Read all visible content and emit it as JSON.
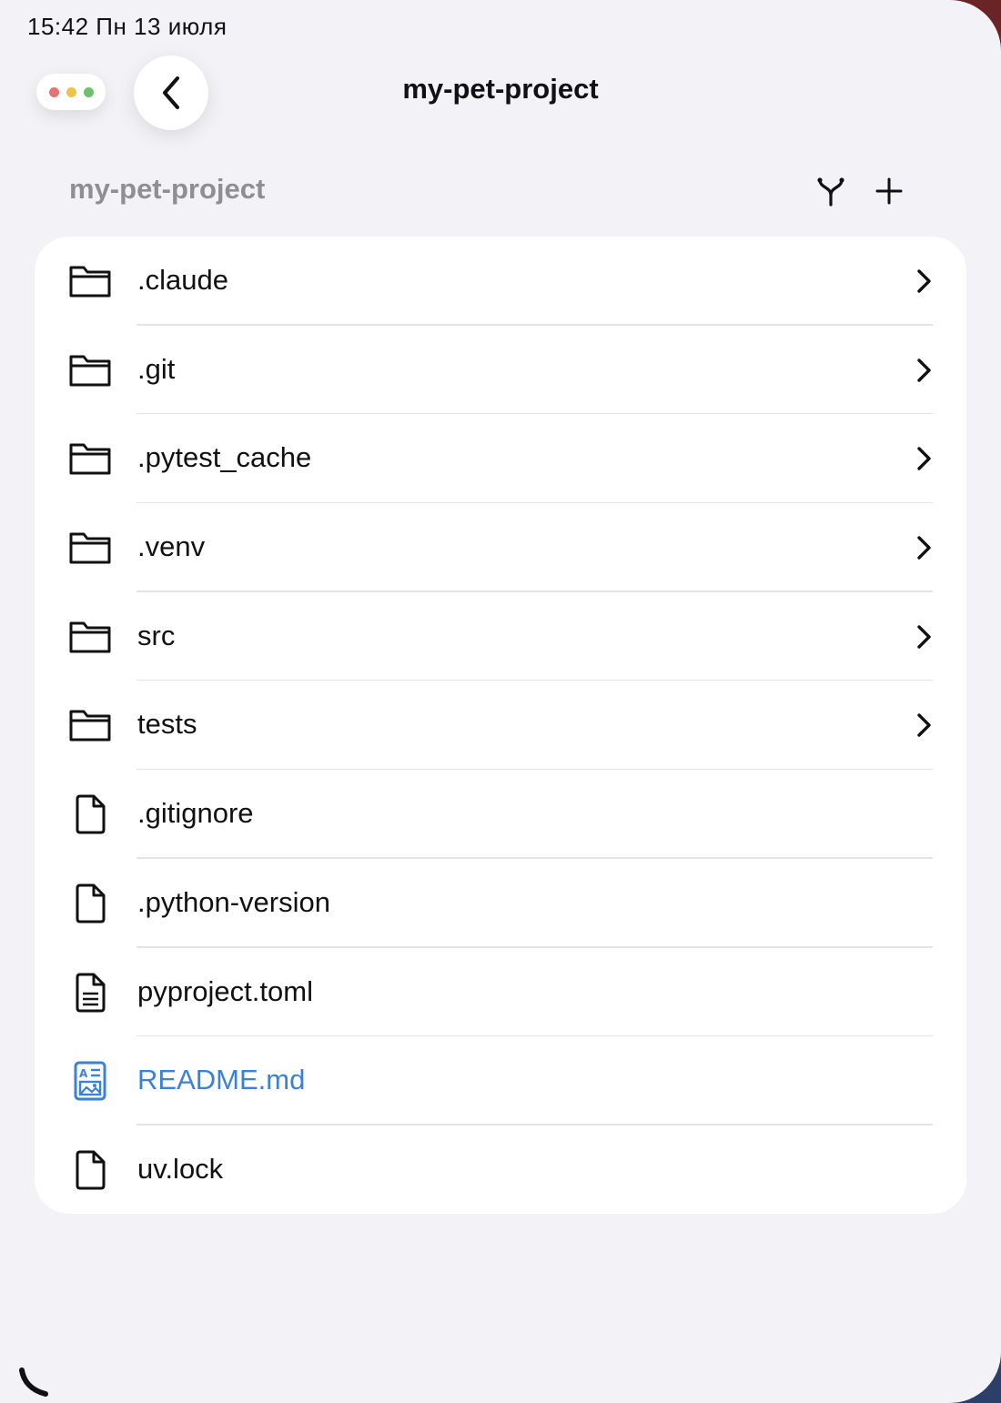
{
  "status_bar": {
    "time_date": "15:42   Пн 13 июля"
  },
  "window_controls": {
    "dot_colors": [
      "#e57373",
      "#f0c14b",
      "#6cc070"
    ]
  },
  "nav": {
    "title": "my-pet-project",
    "back_icon": "chevron-left-icon"
  },
  "section": {
    "title": "my-pet-project",
    "branch_icon": "branch-icon",
    "add_icon": "plus-icon"
  },
  "files": [
    {
      "name": ".claude",
      "type": "folder",
      "icon": "folder-icon",
      "chevron": true
    },
    {
      "name": ".git",
      "type": "folder",
      "icon": "folder-icon",
      "chevron": true
    },
    {
      "name": ".pytest_cache",
      "type": "folder",
      "icon": "folder-icon",
      "chevron": true
    },
    {
      "name": ".venv",
      "type": "folder",
      "icon": "folder-icon",
      "chevron": true
    },
    {
      "name": "src",
      "type": "folder",
      "icon": "folder-icon",
      "chevron": true
    },
    {
      "name": "tests",
      "type": "folder",
      "icon": "folder-icon",
      "chevron": true
    },
    {
      "name": ".gitignore",
      "type": "file",
      "icon": "document-icon",
      "chevron": false
    },
    {
      "name": ".python-version",
      "type": "file",
      "icon": "document-icon",
      "chevron": false
    },
    {
      "name": "pyproject.toml",
      "type": "file",
      "icon": "text-document-icon",
      "chevron": false
    },
    {
      "name": "README.md",
      "type": "file",
      "icon": "markdown-document-icon",
      "chevron": false,
      "accent": true
    },
    {
      "name": "uv.lock",
      "type": "file",
      "icon": "document-icon",
      "chevron": false
    }
  ],
  "colors": {
    "background": "#f2f2f7",
    "card": "#ffffff",
    "accent": "#3b82d6",
    "secondary_text": "#8e8e93"
  },
  "bottom_icon": "phone-icon"
}
